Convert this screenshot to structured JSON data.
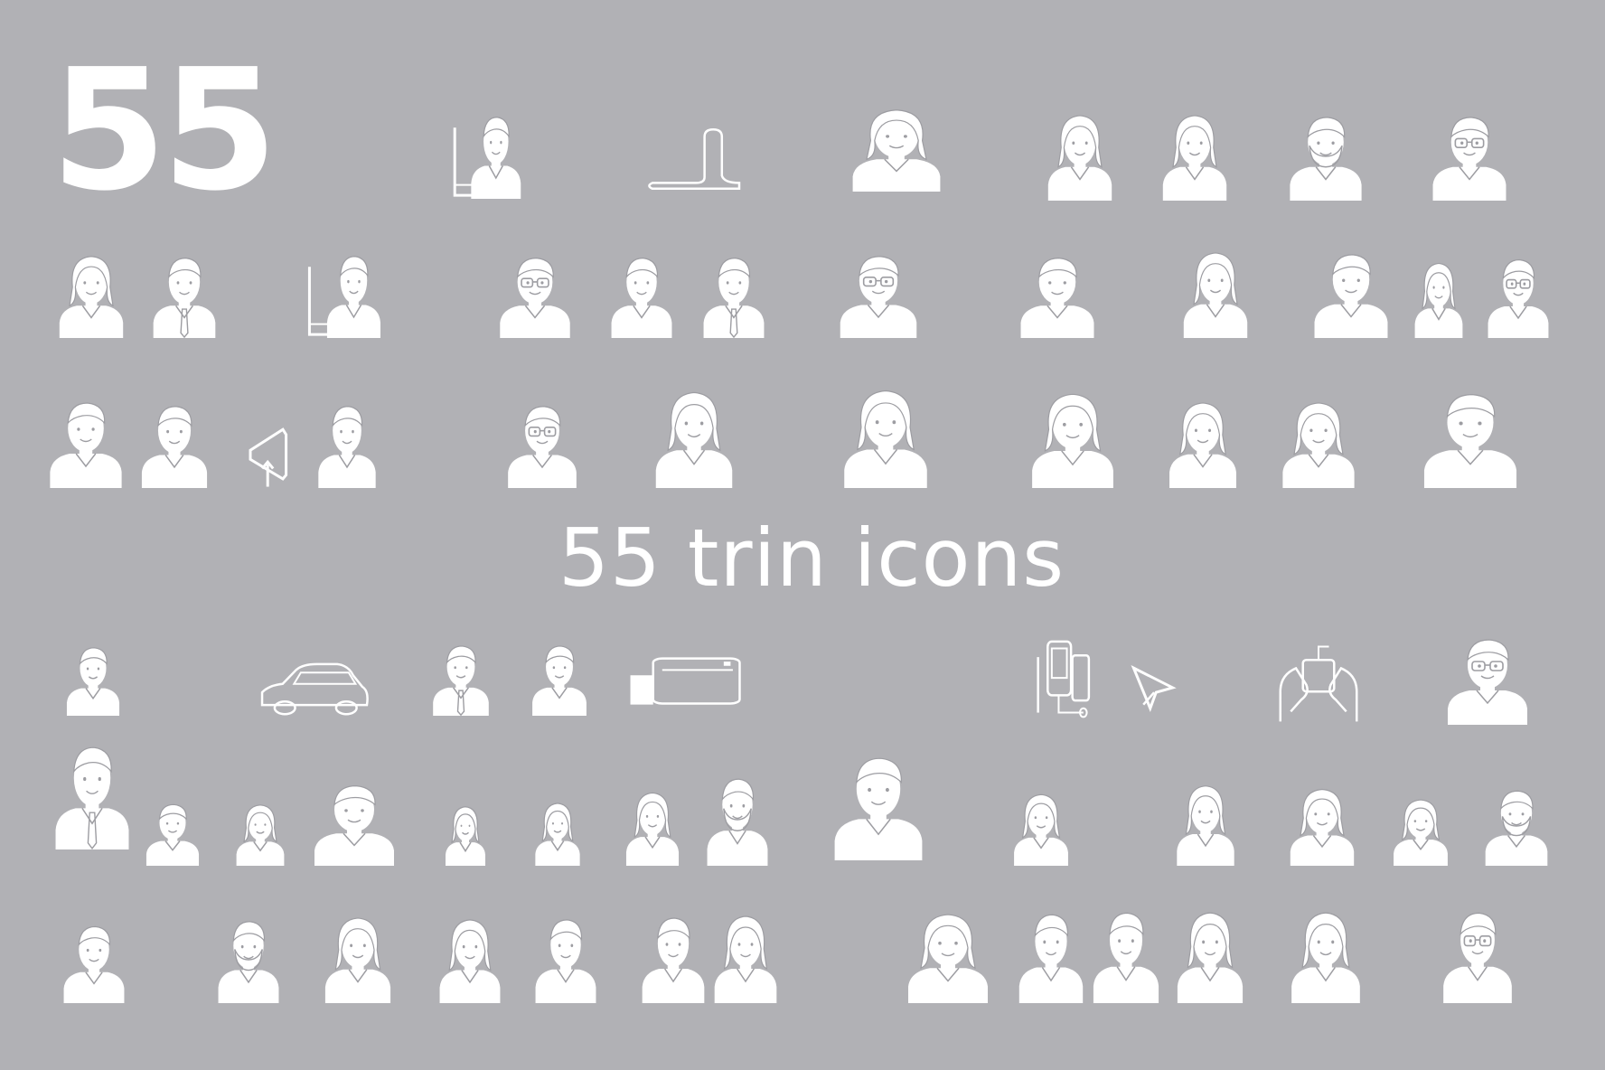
{
  "hero": {
    "number": "55"
  },
  "headline": {
    "text": "55 trin icons"
  },
  "colors": {
    "background": "#b1b1b5",
    "foreground": "#ffffff",
    "line": "#9d9da2"
  },
  "icons": [
    {
      "name": "avatar-glasses-at-board-icon",
      "kind": "board"
    },
    {
      "name": "abstract-shape-icon",
      "kind": "shape"
    },
    {
      "name": "avatar-woman-earring-icon",
      "kind": "woman"
    },
    {
      "name": "avatar-woman-necklace-icon",
      "kind": "woman"
    },
    {
      "name": "avatar-woman-ponytail-icon",
      "kind": "woman"
    },
    {
      "name": "avatar-man-beard-icon",
      "kind": "beard"
    },
    {
      "name": "avatar-man-glasses-icon",
      "kind": "glasses"
    },
    {
      "name": "avatar-woman-bun-icon",
      "kind": "woman"
    },
    {
      "name": "avatar-man-tie-icon",
      "kind": "tie"
    },
    {
      "name": "avatar-presenter-board-icon",
      "kind": "board"
    },
    {
      "name": "avatar-man-glasses-icon",
      "kind": "glasses"
    },
    {
      "name": "avatar-man-icon",
      "kind": "man"
    },
    {
      "name": "avatar-man-tie-icon",
      "kind": "tie"
    },
    {
      "name": "avatar-man-glasses-icon",
      "kind": "glasses"
    },
    {
      "name": "avatar-man-icon",
      "kind": "man"
    },
    {
      "name": "avatar-woman-phone-icon",
      "kind": "woman"
    },
    {
      "name": "avatar-man-spiky-icon",
      "kind": "man"
    },
    {
      "name": "avatar-woman-suit-icon",
      "kind": "woman"
    },
    {
      "name": "avatar-man-glasses-icon",
      "kind": "glasses"
    },
    {
      "name": "avatar-man-shirt-icon",
      "kind": "man"
    },
    {
      "name": "avatar-man-shirt-icon",
      "kind": "man"
    },
    {
      "name": "megaphone-icon",
      "kind": "megaphone"
    },
    {
      "name": "avatar-man-collar-icon",
      "kind": "man"
    },
    {
      "name": "avatar-man-glasses-tie-icon",
      "kind": "glasses"
    },
    {
      "name": "avatar-woman-long-hair-icon",
      "kind": "woman"
    },
    {
      "name": "avatar-woman-sunglasses-icon",
      "kind": "woman"
    },
    {
      "name": "avatar-woman-headset-icon",
      "kind": "woman"
    },
    {
      "name": "avatar-woman-earrings-icon",
      "kind": "woman"
    },
    {
      "name": "avatar-woman-bob-icon",
      "kind": "woman"
    },
    {
      "name": "avatar-man-icon",
      "kind": "man"
    },
    {
      "name": "avatar-man-mustache-icon",
      "kind": "man"
    },
    {
      "name": "car-icon",
      "kind": "car"
    },
    {
      "name": "avatar-man-suit-icon",
      "kind": "tie"
    },
    {
      "name": "avatar-man-icon",
      "kind": "man"
    },
    {
      "name": "wallet-card-icon",
      "kind": "wallet"
    },
    {
      "name": "phone-devices-icon",
      "kind": "phones"
    },
    {
      "name": "cursor-arrow-icon",
      "kind": "cursor"
    },
    {
      "name": "hands-tablet-icon",
      "kind": "hands"
    },
    {
      "name": "avatar-man-glasses-icon",
      "kind": "glasses"
    },
    {
      "name": "avatar-man-suit-tie-icon",
      "kind": "tie"
    },
    {
      "name": "avatar-boy-icon",
      "kind": "man"
    },
    {
      "name": "avatar-woman-icon",
      "kind": "woman"
    },
    {
      "name": "avatar-man-selfie-icon",
      "kind": "man"
    },
    {
      "name": "avatar-woman-profile-icon",
      "kind": "woman"
    },
    {
      "name": "avatar-woman-wavy-icon",
      "kind": "woman"
    },
    {
      "name": "avatar-woman-icon",
      "kind": "woman"
    },
    {
      "name": "avatar-man-punk-mustache-icon",
      "kind": "beard"
    },
    {
      "name": "avatar-man-smiling-icon",
      "kind": "man"
    },
    {
      "name": "avatar-woman-icon",
      "kind": "woman"
    },
    {
      "name": "avatar-woman-side-hair-icon",
      "kind": "woman"
    },
    {
      "name": "avatar-woman-necklace-icon",
      "kind": "woman"
    },
    {
      "name": "avatar-woman-icon",
      "kind": "woman"
    },
    {
      "name": "avatar-man-mustache-icon",
      "kind": "beard"
    },
    {
      "name": "avatar-man-icon",
      "kind": "man"
    },
    {
      "name": "avatar-man-bearded-icon",
      "kind": "beard"
    },
    {
      "name": "avatar-woman-glasses-icon",
      "kind": "woman"
    },
    {
      "name": "avatar-woman-glasses-icon",
      "kind": "woman"
    },
    {
      "name": "avatar-man-icon",
      "kind": "man"
    },
    {
      "name": "avatar-man-collar-icon",
      "kind": "man"
    },
    {
      "name": "avatar-woman-flower-earrings-icon",
      "kind": "woman"
    },
    {
      "name": "avatar-woman-curly-icon",
      "kind": "woman"
    },
    {
      "name": "avatar-man-spiky-icon",
      "kind": "man"
    },
    {
      "name": "avatar-man-quiff-icon",
      "kind": "man"
    },
    {
      "name": "avatar-woman-icon",
      "kind": "woman"
    },
    {
      "name": "avatar-woman-short-hair-icon",
      "kind": "woman"
    },
    {
      "name": "avatar-man-glasses-mustache-icon",
      "kind": "glasses"
    }
  ]
}
